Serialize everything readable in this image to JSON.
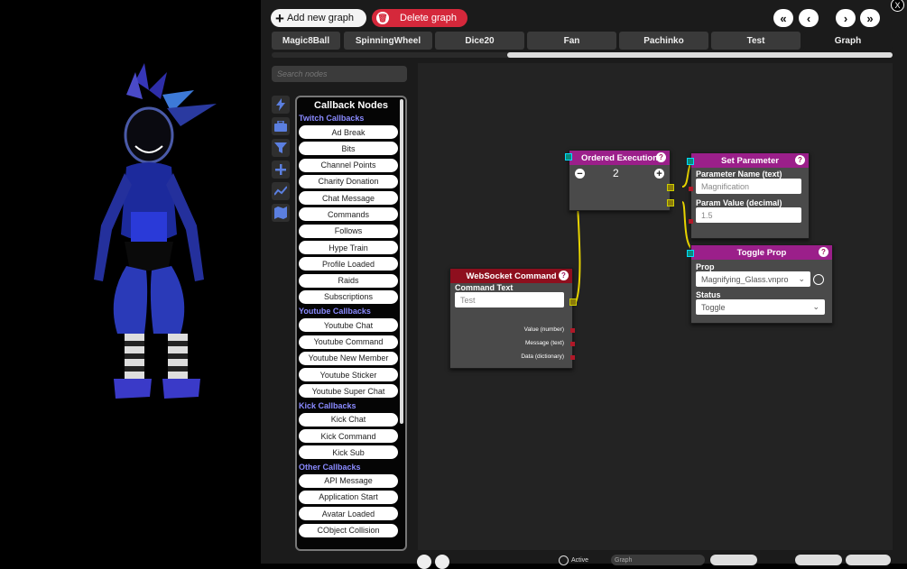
{
  "toolbar": {
    "add_graph_label": "Add new graph",
    "delete_graph_label": "Delete graph",
    "nav": {
      "first": "«",
      "prev": "‹",
      "next": "›",
      "last": "»"
    },
    "close": "X"
  },
  "tabs": [
    "Magic8Ball",
    "SpinningWheel",
    "Dice20",
    "Fan",
    "Pachinko",
    "Test",
    "Graph"
  ],
  "active_tab": "Graph",
  "search": {
    "placeholder": "Search nodes"
  },
  "side_icons": [
    "lightning-icon",
    "toolbox-icon",
    "filter-icon",
    "plus-icon",
    "chart-icon",
    "map-icon"
  ],
  "palette": {
    "title": "Callback Nodes",
    "groups": [
      {
        "name": "Twitch Callbacks",
        "items": [
          "Ad Break",
          "Bits",
          "Channel Points",
          "Charity Donation",
          "Chat Message",
          "Commands",
          "Follows",
          "Hype Train",
          "Profile Loaded",
          "Raids",
          "Subscriptions"
        ]
      },
      {
        "name": "Youtube Callbacks",
        "items": [
          "Youtube Chat",
          "Youtube Command",
          "Youtube New Member",
          "Youtube Sticker",
          "Youtube Super Chat"
        ]
      },
      {
        "name": "Kick Callbacks",
        "items": [
          "Kick Chat",
          "Kick Command",
          "Kick Sub"
        ]
      },
      {
        "name": "Other Callbacks",
        "items": [
          "API Message",
          "Application Start",
          "Avatar Loaded",
          "CObject Collision"
        ]
      }
    ]
  },
  "nodes": {
    "websocket": {
      "title": "WebSocket Command",
      "field_label": "Command Text",
      "field_value": "Test",
      "outputs": [
        "Value (number)",
        "Message (text)",
        "Data (dictionary)"
      ],
      "help": "?"
    },
    "ordered": {
      "title": "Ordered Execution",
      "count": "2",
      "minus": "−",
      "plus": "+",
      "help": "?"
    },
    "set_param": {
      "title": "Set Parameter",
      "name_label": "Parameter Name (text)",
      "name_value": "Magnification",
      "value_label": "Param Value (decimal)",
      "value_value": "1.5",
      "help": "?"
    },
    "toggle_prop": {
      "title": "Toggle Prop",
      "prop_label": "Prop",
      "prop_value": "Magnifying_Glass.vnpro",
      "status_label": "Status",
      "status_value": "Toggle",
      "help": "?"
    }
  },
  "colors": {
    "accent_delete": "#d5283b",
    "node_header_dark_red": "#8e0f1e",
    "node_header_purple": "#9b1f8a",
    "connection": "#e8d400",
    "group_label": "#8a8aff"
  },
  "bottom_bar": {
    "active_label": "Active",
    "search_label": "Graph"
  }
}
